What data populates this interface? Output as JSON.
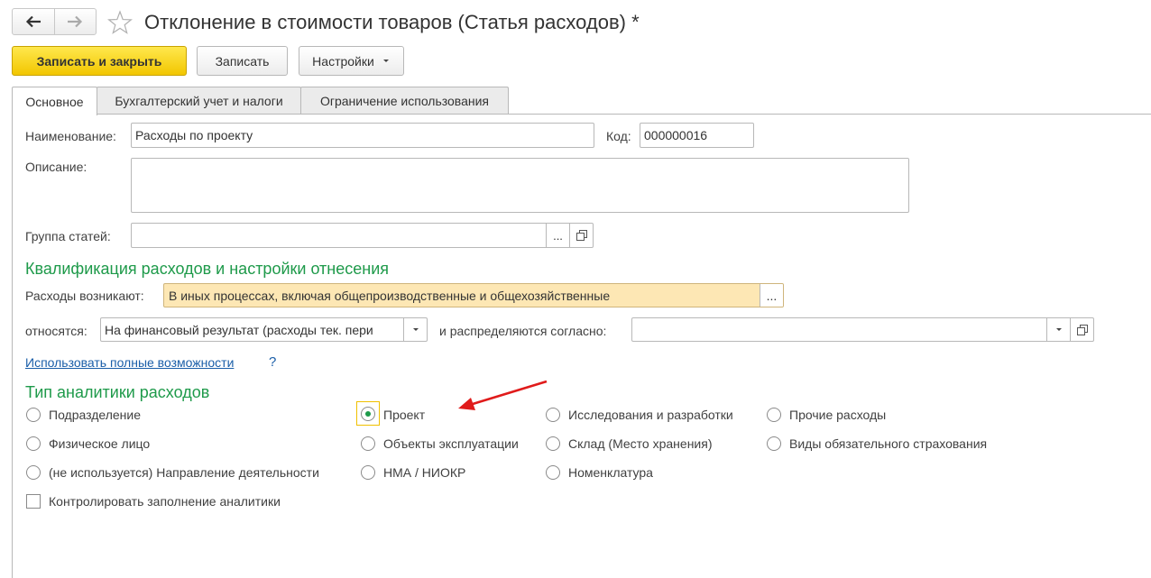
{
  "window": {
    "title": "Отклонение в стоимости товаров (Статья расходов) *"
  },
  "toolbar": {
    "save_close": "Записать и закрыть",
    "save": "Записать",
    "settings": "Настройки"
  },
  "tabs": [
    {
      "label": "Основное",
      "active": true
    },
    {
      "label": "Бухгалтерский учет и налоги",
      "active": false
    },
    {
      "label": "Ограничение использования",
      "active": false
    }
  ],
  "form": {
    "name_label": "Наименование:",
    "name_value": "Расходы по проекту",
    "code_label": "Код:",
    "code_value": "000000016",
    "description_label": "Описание:",
    "description_value": "",
    "group_label": "Группа статей:",
    "group_value": "",
    "ellipsis": "...",
    "section_qualification": "Квалификация расходов и настройки отнесения",
    "expenses_arise_label": "Расходы возникают:",
    "expenses_arise_value": "В иных процессах, включая общепроизводственные и общехозяйственные",
    "belong_label": "относятся:",
    "belong_value": "На финансовый результат (расходы тек. пери",
    "distributed_label": "и распределяются согласно:",
    "distributed_value": "",
    "full_features_link": "Использовать полные возможности",
    "help_mark": "?",
    "section_analytics": "Тип аналитики расходов",
    "control_label": "Контролировать заполнение аналитики",
    "control_checked": false
  },
  "analytics_types": [
    {
      "label": "Подразделение",
      "checked": false
    },
    {
      "label": "Физическое лицо",
      "checked": false
    },
    {
      "label": "(не используется) Направление деятельности",
      "checked": false
    },
    {
      "label": "Проект",
      "checked": true
    },
    {
      "label": "Объекты эксплуатации",
      "checked": false
    },
    {
      "label": "НМА / НИОКР",
      "checked": false
    },
    {
      "label": "Исследования и разработки",
      "checked": false
    },
    {
      "label": "Склад (Место хранения)",
      "checked": false
    },
    {
      "label": "Номенклатура",
      "checked": false
    },
    {
      "label": "Прочие расходы",
      "checked": false
    },
    {
      "label": "Виды обязательного страхования",
      "checked": false
    }
  ],
  "colors": {
    "accent_green": "#1e9a4a",
    "primary_button": "#f2c600",
    "highlight_field": "#fde7b4",
    "annotation_arrow": "#e01b1b",
    "link": "#1a5ea8"
  }
}
